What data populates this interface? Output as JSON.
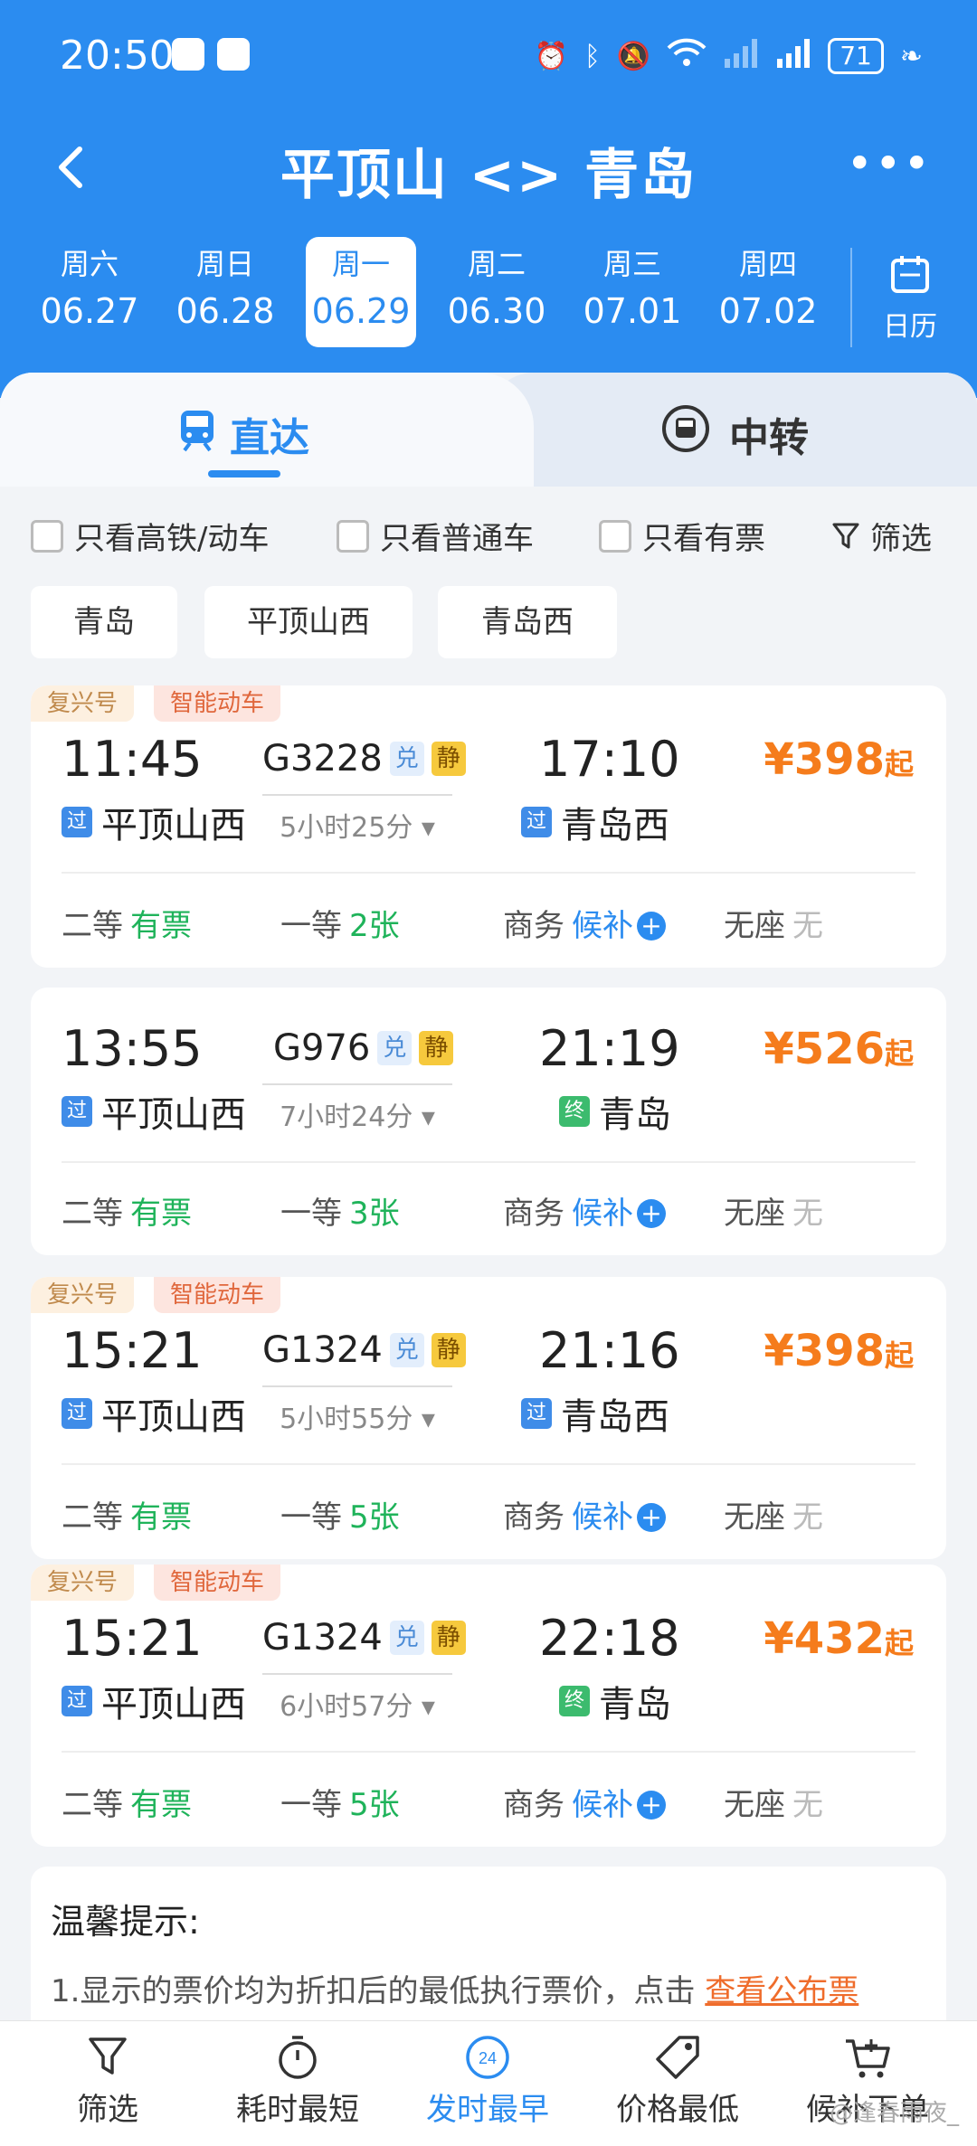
{
  "status": {
    "time": "20:50",
    "battery": "71"
  },
  "header": {
    "title": "平顶山 <> 青岛"
  },
  "dates": [
    {
      "weekday": "周六",
      "date": "06.27"
    },
    {
      "weekday": "周日",
      "date": "06.28"
    },
    {
      "weekday": "周一",
      "date": "06.29"
    },
    {
      "weekday": "周二",
      "date": "06.30"
    },
    {
      "weekday": "周三",
      "date": "07.01"
    },
    {
      "weekday": "周四",
      "date": "07.02"
    }
  ],
  "calendar_label": "日历",
  "tabs": {
    "direct": "直达",
    "transfer": "中转"
  },
  "filters": {
    "high_speed": "只看高铁/动车",
    "normal": "只看普通车",
    "available": "只看有票",
    "filter": "筛选"
  },
  "stations": [
    "青岛",
    "平顶山西",
    "青岛西"
  ],
  "trains": [
    {
      "tag1": "复兴号",
      "tag2": "智能动车",
      "dep_time": "11:45",
      "arr_time": "17:10",
      "train_no": "G3228",
      "badge_dui": "兑",
      "badge_jing": "静",
      "duration": "5小时25分",
      "dep_mark": "过",
      "dep_station": "平顶山西",
      "arr_mark": "过",
      "arr_station": "青岛西",
      "price": "¥398",
      "price_suffix": "起",
      "seats": {
        "second_label": "二等",
        "second": "有票",
        "first_label": "一等",
        "first": "2张",
        "business_label": "商务",
        "business": "候补",
        "none_label": "无座",
        "none": "无"
      }
    },
    {
      "dep_time": "13:55",
      "arr_time": "21:19",
      "train_no": "G976",
      "badge_dui": "兑",
      "badge_jing": "静",
      "duration": "7小时24分",
      "dep_mark": "过",
      "dep_station": "平顶山西",
      "arr_mark": "终",
      "arr_station": "青岛",
      "price": "¥526",
      "price_suffix": "起",
      "seats": {
        "second_label": "二等",
        "second": "有票",
        "first_label": "一等",
        "first": "3张",
        "business_label": "商务",
        "business": "候补",
        "none_label": "无座",
        "none": "无"
      }
    },
    {
      "tag1": "复兴号",
      "tag2": "智能动车",
      "dep_time": "15:21",
      "arr_time": "21:16",
      "train_no": "G1324",
      "badge_dui": "兑",
      "badge_jing": "静",
      "duration": "5小时55分",
      "dep_mark": "过",
      "dep_station": "平顶山西",
      "arr_mark": "过",
      "arr_station": "青岛西",
      "price": "¥398",
      "price_suffix": "起",
      "seats": {
        "second_label": "二等",
        "second": "有票",
        "first_label": "一等",
        "first": "5张",
        "business_label": "商务",
        "business": "候补",
        "none_label": "无座",
        "none": "无"
      }
    },
    {
      "tag1": "复兴号",
      "tag2": "智能动车",
      "dep_time": "15:21",
      "arr_time": "22:18",
      "train_no": "G1324",
      "badge_dui": "兑",
      "badge_jing": "静",
      "duration": "6小时57分",
      "dep_mark": "过",
      "dep_station": "平顶山西",
      "arr_mark": "终",
      "arr_station": "青岛",
      "price": "¥432",
      "price_suffix": "起",
      "seats": {
        "second_label": "二等",
        "second": "有票",
        "first_label": "一等",
        "first": "5张",
        "business_label": "商务",
        "business": "候补",
        "none_label": "无座",
        "none": "无"
      }
    }
  ],
  "tips": {
    "heading": "温馨提示:",
    "text": "1.显示的票价均为折扣后的最低执行票价，点击",
    "link": "查看公布票"
  },
  "bottom_nav": [
    {
      "label": "筛选",
      "icon": "filter-icon"
    },
    {
      "label": "耗时最短",
      "icon": "stopwatch-icon"
    },
    {
      "label": "发时最早",
      "icon": "clock-24-icon",
      "badge": "24"
    },
    {
      "label": "价格最低",
      "icon": "price-tag-icon"
    },
    {
      "label": "候补下单",
      "icon": "cart-icon"
    }
  ],
  "watermark": "@逢春雨夜_"
}
